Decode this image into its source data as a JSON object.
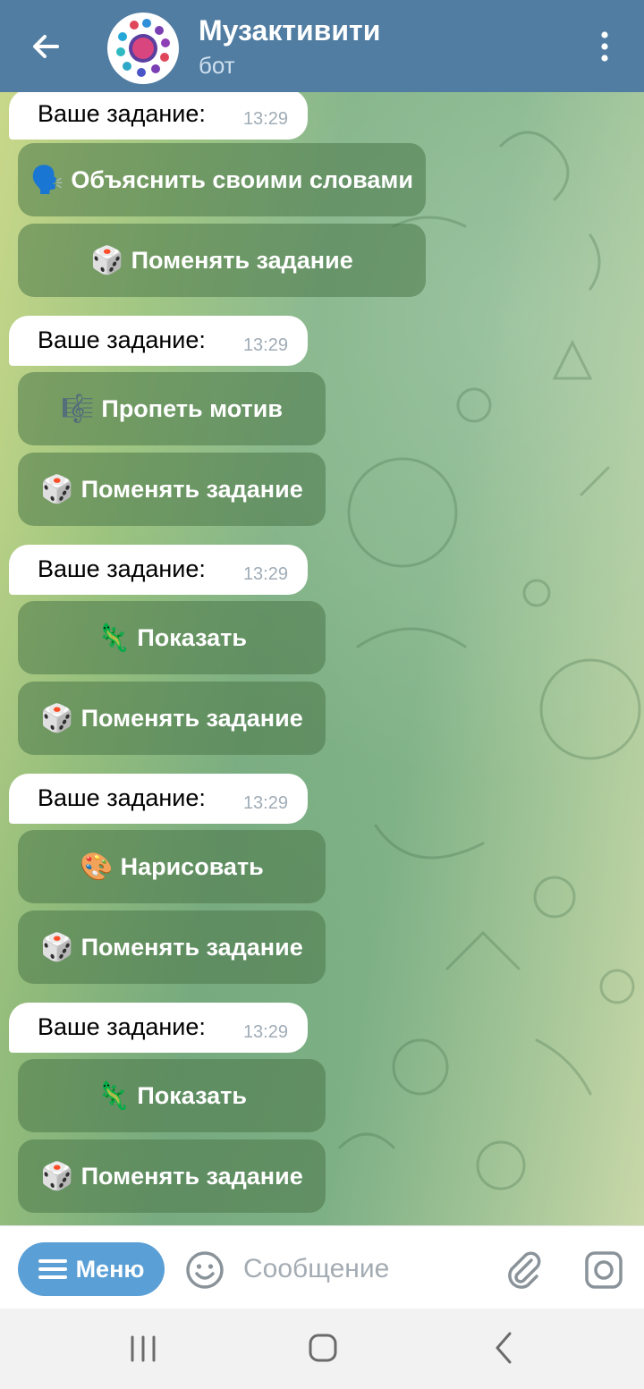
{
  "header": {
    "title": "Музактивити",
    "subtitle": "бот"
  },
  "messages": [
    {
      "text": "Ваше задание:",
      "time": "13:29"
    },
    {
      "text": "Ваше задание:",
      "time": "13:29"
    },
    {
      "text": "Ваше задание:",
      "time": "13:29"
    },
    {
      "text": "Ваше задание:",
      "time": "13:29"
    },
    {
      "text": "Ваше задание:",
      "time": "13:29"
    }
  ],
  "buttons": [
    {
      "emoji": "🗣️",
      "label": "Объяснить своими словами"
    },
    {
      "emoji": "🎲",
      "label": "Поменять задание"
    },
    {
      "emoji": "🎼",
      "label": "Пропеть мотив"
    },
    {
      "emoji": "🎲",
      "label": "Поменять задание"
    },
    {
      "emoji": "🦎",
      "label": "Показать"
    },
    {
      "emoji": "🎲",
      "label": "Поменять задание"
    },
    {
      "emoji": "🎨",
      "label": "Нарисовать"
    },
    {
      "emoji": "🎲",
      "label": "Поменять задание"
    },
    {
      "emoji": "🦎",
      "label": "Показать"
    },
    {
      "emoji": "🎲",
      "label": "Поменять задание"
    }
  ],
  "composer": {
    "menu_label": "Меню",
    "placeholder": "Сообщение"
  },
  "colors": {
    "header": "#517da2",
    "menu_button": "#5a9fd6",
    "keyboard_button": "#4a7648"
  }
}
